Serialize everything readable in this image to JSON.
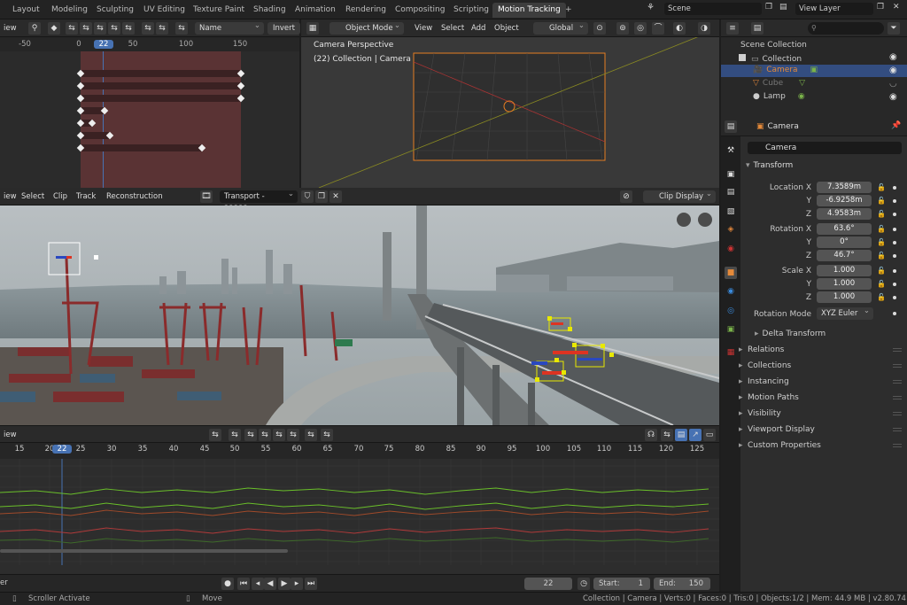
{
  "tabs": [
    "Layout",
    "Modeling",
    "Sculpting",
    "UV Editing",
    "Texture Paint",
    "Shading",
    "Animation",
    "Rendering",
    "Compositing",
    "Scripting",
    "Motion Tracking",
    "+"
  ],
  "scene": {
    "label": "Scene",
    "view_layer": "View Layer"
  },
  "dopesheet": {
    "view": "iew",
    "name_dd": "Name",
    "invert": "Invert",
    "ruler": [
      "-50",
      "0",
      "22",
      "50",
      "100",
      "150"
    ]
  },
  "viewport": {
    "mode": "Object Mode",
    "menus": [
      "View",
      "Select",
      "Add",
      "Object"
    ],
    "orientation": "Global",
    "title": "Camera Perspective",
    "subtitle": "(22) Collection | Camera"
  },
  "clip": {
    "menus": [
      "iew",
      "Select",
      "Clip",
      "Track",
      "Reconstruction"
    ],
    "clip_name": "Transport - 23232...",
    "display": "Clip Display"
  },
  "graph": {
    "view": "iew",
    "ruler": [
      "15",
      "20",
      "22",
      "25",
      "30",
      "35",
      "40",
      "45",
      "50",
      "55",
      "60",
      "65",
      "70",
      "75",
      "80",
      "85",
      "90",
      "95",
      "100",
      "105",
      "110",
      "115",
      "120",
      "125"
    ]
  },
  "playback": {
    "left": "er",
    "frame": "22",
    "start_label": "Start:",
    "start": "1",
    "end_label": "End:",
    "end": "150"
  },
  "outliner": {
    "items": [
      {
        "label": "Scene Collection"
      },
      {
        "label": "Collection"
      },
      {
        "label": "Camera"
      },
      {
        "label": "Cube"
      },
      {
        "label": "Lamp"
      }
    ]
  },
  "properties": {
    "object_name": "Camera",
    "data_name": "Camera",
    "transform": "Transform",
    "location_label": "Location X",
    "loc": [
      "7.3589m",
      "-6.9258m",
      "4.9583m"
    ],
    "rotation_label": "Rotation X",
    "rot": [
      "63.6°",
      "0°",
      "46.7°"
    ],
    "scale_label": "Scale X",
    "scale": [
      "1.000",
      "1.000",
      "1.000"
    ],
    "y": "Y",
    "z": "Z",
    "rotation_mode_label": "Rotation Mode",
    "rotation_mode": "XYZ Euler",
    "delta": "Delta Transform",
    "sections": [
      "Relations",
      "Collections",
      "Instancing",
      "Motion Paths",
      "Visibility",
      "Viewport Display",
      "Custom Properties"
    ]
  },
  "status": {
    "scroller": "Scroller Activate",
    "move": "Move",
    "info": "Collection | Camera | Verts:0 | Faces:0 | Tris:0 | Objects:1/2 | Mem: 44.9 MB | v2.80.74"
  },
  "colors": {
    "accent": "#4772b3",
    "keyframe_row": "#5a3334",
    "tracker": "#e8e800",
    "active_tab": "#3d3d3d"
  }
}
